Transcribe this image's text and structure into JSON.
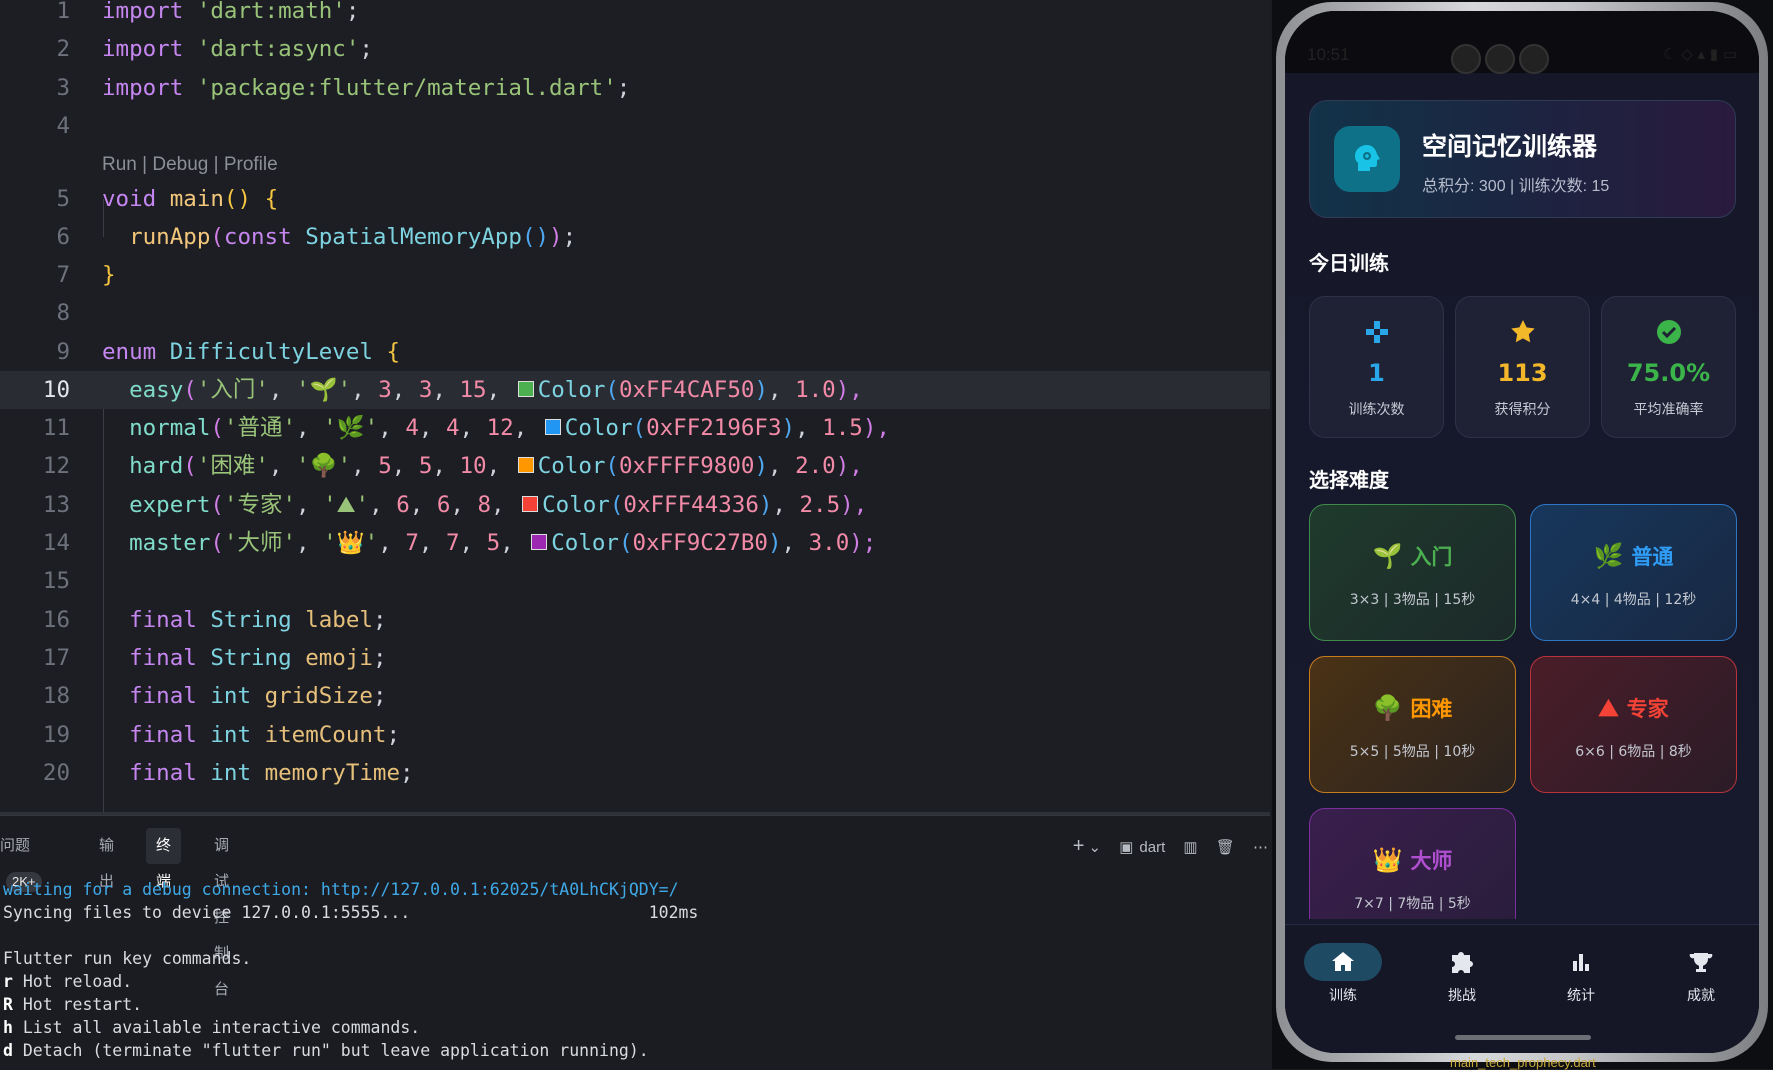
{
  "editor": {
    "codelens": "Run | Debug | Profile",
    "lines": [
      {
        "n": "1"
      },
      {
        "n": "2"
      },
      {
        "n": "3"
      },
      {
        "n": "4"
      },
      {
        "n": "5"
      },
      {
        "n": "6"
      },
      {
        "n": "7"
      },
      {
        "n": "8"
      },
      {
        "n": "9"
      },
      {
        "n": "10"
      },
      {
        "n": "11"
      },
      {
        "n": "12"
      },
      {
        "n": "13"
      },
      {
        "n": "14"
      },
      {
        "n": "15"
      },
      {
        "n": "16"
      },
      {
        "n": "17"
      },
      {
        "n": "18"
      },
      {
        "n": "19"
      },
      {
        "n": "20"
      }
    ],
    "code": {
      "imp1": "'dart:math'",
      "imp2": "'dart:async'",
      "imp3": "'package:flutter/material.dart'",
      "kw_import": "import",
      "kw_void": "void",
      "fn_main": "main",
      "fn_runApp": "runApp",
      "kw_const": "const",
      "cls_app": "SpatialMemoryApp",
      "kw_enum": "enum",
      "enum_name": "DifficultyLevel",
      "kw_final": "final",
      "ty_string": "String",
      "ty_int": "int",
      "f_label": "label",
      "f_emoji": "emoji",
      "f_grid": "gridSize",
      "f_item": "itemCount",
      "f_mem": "memoryTime",
      "levels": [
        {
          "name": "easy",
          "label": "'入门'",
          "emoji": "'🌱'",
          "a": "3",
          "b": "3",
          "c": "15",
          "color": "0xFF4CAF50",
          "swatch": "#4CAF50",
          "mult": "1.0",
          "end": "),"
        },
        {
          "name": "normal",
          "label": "'普通'",
          "emoji": "'🌿'",
          "a": "4",
          "b": "4",
          "c": "12",
          "color": "0xFF2196F3",
          "swatch": "#2196F3",
          "mult": "1.5",
          "end": "),"
        },
        {
          "name": "hard",
          "label": "'困难'",
          "emoji": "'🌳'",
          "a": "5",
          "b": "5",
          "c": "10",
          "color": "0xFFFF9800",
          "swatch": "#FF9800",
          "mult": "2.0",
          "end": "),"
        },
        {
          "name": "expert",
          "label": "'专家'",
          "emoji": "'⛰'",
          "a": "6",
          "b": "6",
          "c": "8",
          "color": "0xFFF44336",
          "swatch": "#F44336",
          "mult": "2.5",
          "end": "),"
        },
        {
          "name": "master",
          "label": "'大师'",
          "emoji": "'👑'",
          "a": "7",
          "b": "7",
          "c": "5",
          "color": "0xFF9C27B0",
          "swatch": "#9C27B0",
          "mult": "3.0",
          "end": ");"
        }
      ]
    }
  },
  "panel": {
    "tabs": {
      "problems": "问题",
      "problems_count": "2K+",
      "output": "输出",
      "terminal": "终端",
      "debug": "调试控制台"
    },
    "tools": {
      "add": "+",
      "chev": "⌄",
      "shell": "dart",
      "split": "▥",
      "trash": "🗑",
      "more": "⋯"
    },
    "terminal": {
      "l1": "waiting for a debug connection: http://127.0.0.1:62025/tA0LhCKjQDY=/",
      "l2": "Syncing files to device 127.0.0.1:5555...                        102ms",
      "l3": "Flutter run key commands.",
      "l4k": "r",
      "l4": " Hot reload.",
      "l5k": "R",
      "l5": " Hot restart.",
      "l6k": "h",
      "l6": " List all available interactive commands.",
      "l7k": "d",
      "l7": " Detach (terminate \"flutter run\" but leave application running)."
    }
  },
  "phone": {
    "status_time": "10:51",
    "header": {
      "title": "空间记忆训练器",
      "subtitle": "总积分: 300 | 训练次数: 15"
    },
    "today_title": "今日训练",
    "stats": [
      {
        "value": "1",
        "label": "训练次数",
        "color": "#2aa7e8",
        "icon": "gamepad-icon"
      },
      {
        "value": "113",
        "label": "获得积分",
        "color": "#f3b82a",
        "icon": "star-icon"
      },
      {
        "value": "75.0%",
        "label": "平均准确率",
        "color": "#3bb44a",
        "icon": "check-circle-icon"
      }
    ],
    "difficulty_title": "选择难度",
    "levels": [
      {
        "emoji": "🌱",
        "name": "入门",
        "desc": "3×3 | 3物品 | 15秒",
        "color": "#4CAF50"
      },
      {
        "emoji": "🌿",
        "name": "普通",
        "desc": "4×4 | 4物品 | 12秒",
        "color": "#2196F3"
      },
      {
        "emoji": "🌳",
        "name": "困难",
        "desc": "5×5 | 5物品 | 10秒",
        "color": "#FF9800"
      },
      {
        "emoji": "⛰",
        "name": "专家",
        "desc": "6×6 | 6物品 | 8秒",
        "color": "#F44336"
      },
      {
        "emoji": "👑",
        "name": "大师",
        "desc": "7×7 | 7物品 | 5秒",
        "color": "#9C27B0"
      }
    ],
    "nav": [
      {
        "label": "训练",
        "icon": "home-icon",
        "active": true
      },
      {
        "label": "挑战",
        "icon": "puzzle-icon",
        "active": false
      },
      {
        "label": "统计",
        "icon": "bar-chart-icon",
        "active": false
      },
      {
        "label": "成就",
        "icon": "trophy-icon",
        "active": false
      }
    ]
  },
  "behind_text": "main_tech_prophecy.dart"
}
